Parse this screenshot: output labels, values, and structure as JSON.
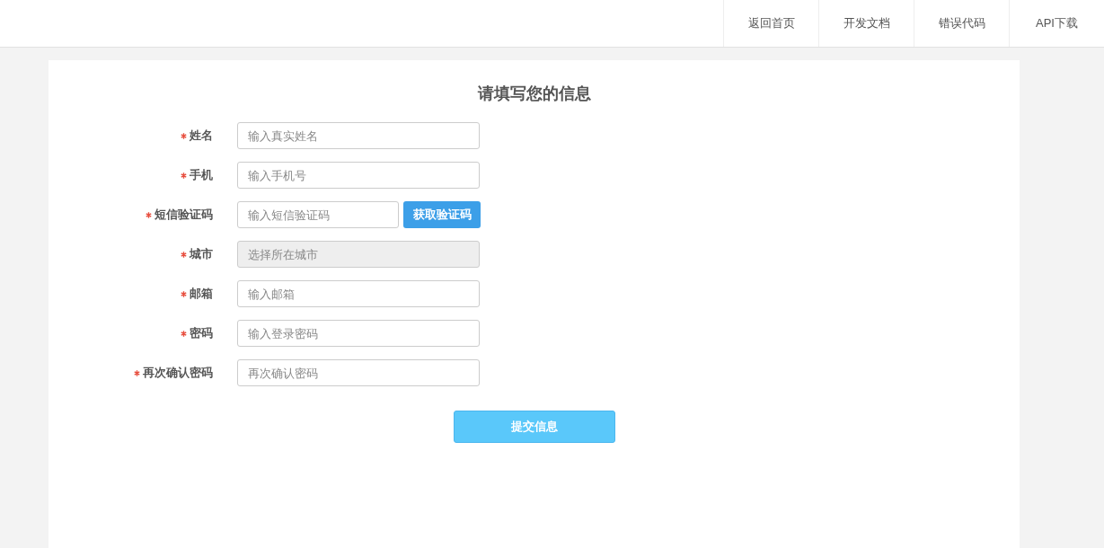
{
  "nav": [
    {
      "label": "返回首页"
    },
    {
      "label": "开发文档"
    },
    {
      "label": "错误代码"
    },
    {
      "label": "API下载"
    }
  ],
  "form": {
    "title": "请填写您的信息",
    "fields": [
      {
        "kind": "text",
        "label": "姓名",
        "required": true,
        "placeholder": "输入真实姓名",
        "disabled": false
      },
      {
        "kind": "text",
        "label": "手机",
        "required": true,
        "placeholder": "输入手机号",
        "disabled": false
      },
      {
        "kind": "code",
        "label": "短信验证码",
        "required": true,
        "placeholder": "输入短信验证码",
        "disabled": false,
        "button": "获取验证码"
      },
      {
        "kind": "text",
        "label": "城市",
        "required": true,
        "placeholder": "选择所在城市",
        "disabled": true
      },
      {
        "kind": "text",
        "label": "邮箱",
        "required": true,
        "placeholder": "输入邮箱",
        "disabled": false
      },
      {
        "kind": "text",
        "label": "密码",
        "required": true,
        "placeholder": "输入登录密码",
        "disabled": false
      },
      {
        "kind": "text",
        "label": "再次确认密码",
        "required": true,
        "placeholder": "再次确认密码",
        "disabled": false
      }
    ],
    "submit": "提交信息"
  }
}
